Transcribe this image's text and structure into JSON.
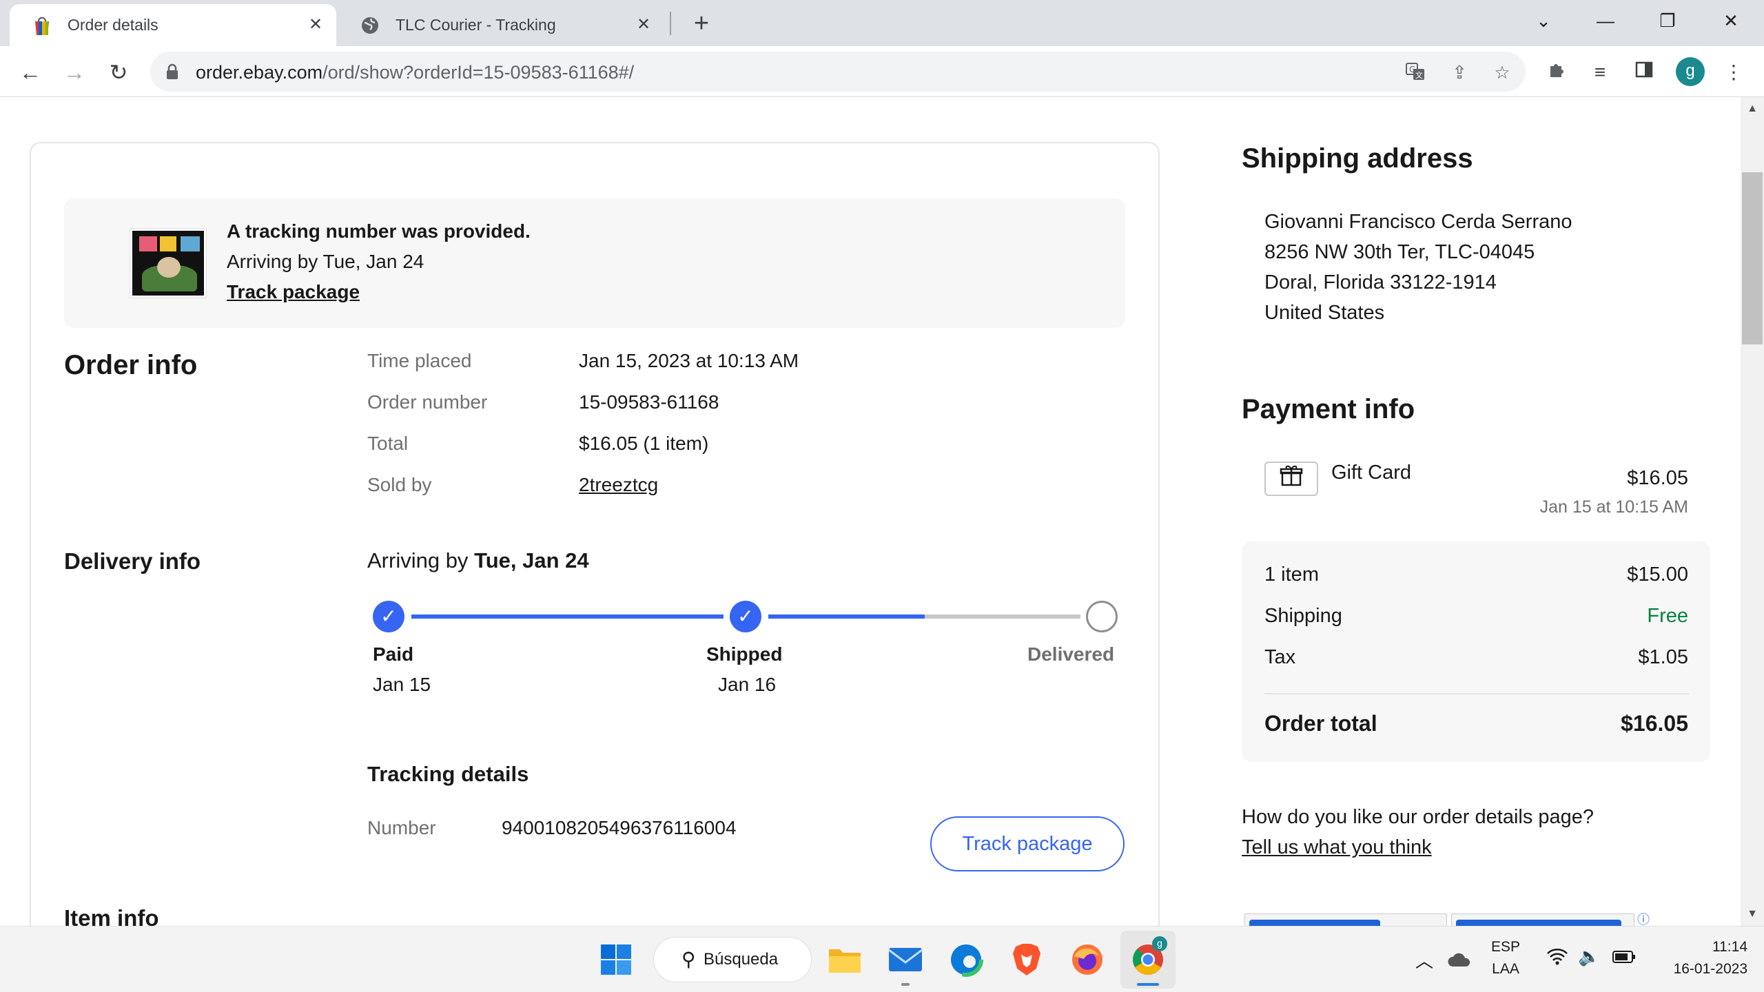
{
  "browser": {
    "tabs": [
      {
        "title": "Order details",
        "active": true
      },
      {
        "title": "TLC Courier - Tracking",
        "active": false
      }
    ],
    "url_host": "order.ebay.com",
    "url_path": "/ord/show?orderId=15-09583-61168#/",
    "profile_initial": "g"
  },
  "banner": {
    "title": "A tracking number was provided.",
    "subtitle": "Arriving by Tue, Jan 24",
    "link": "Track package"
  },
  "order_info": {
    "heading": "Order info",
    "rows": [
      {
        "label": "Time placed",
        "value": "Jan 15, 2023 at 10:13 AM"
      },
      {
        "label": "Order number",
        "value": "15-09583-61168"
      },
      {
        "label": "Total",
        "value": "$16.05 (1 item)"
      },
      {
        "label": "Sold by",
        "value": "2treeztcg"
      }
    ]
  },
  "delivery": {
    "heading": "Delivery info",
    "arriving_prefix": "Arriving by",
    "arriving_date": "Tue, Jan 24",
    "progress_fraction": 0.75,
    "steps": [
      {
        "label": "Paid",
        "date": "Jan 15",
        "done": true
      },
      {
        "label": "Shipped",
        "date": "Jan 16",
        "done": true
      },
      {
        "label": "Delivered",
        "date": "",
        "done": false
      }
    ]
  },
  "tracking": {
    "heading": "Tracking details",
    "number_label": "Number",
    "number": "9400108205496376116004",
    "button": "Track package"
  },
  "item_info": {
    "heading": "Item info"
  },
  "shipping_address": {
    "heading": "Shipping address",
    "lines": [
      "Giovanni Francisco Cerda Serrano",
      "8256 NW 30th Ter, TLC-04045",
      "Doral, Florida 33122-1914",
      "United States"
    ]
  },
  "payment": {
    "heading": "Payment info",
    "method": "Gift Card",
    "amount": "$16.05",
    "date": "Jan 15 at 10:15 AM",
    "summary": [
      {
        "label": "1 item",
        "value": "$15.00"
      },
      {
        "label": "Shipping",
        "value": "Free"
      },
      {
        "label": "Tax",
        "value": "$1.05"
      }
    ],
    "total_label": "Order total",
    "total_value": "$16.05"
  },
  "feedback": {
    "question": "How do you like our order details page?",
    "link": "Tell us what you think"
  },
  "taskbar": {
    "search_label": "Búsqueda",
    "lang_top": "ESP",
    "lang_bottom": "LAA",
    "time": "11:14",
    "date": "16-01-2023",
    "chrome_badge": "g"
  },
  "colors": {
    "accent": "#3665f3",
    "free_green": "#05823f",
    "muted": "#707070"
  }
}
